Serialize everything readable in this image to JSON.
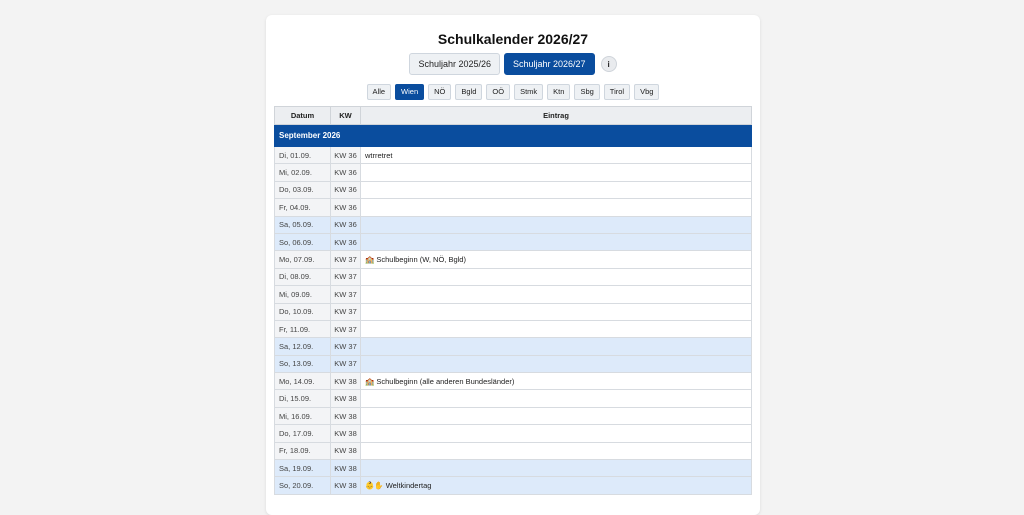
{
  "header": {
    "title": "Schulkalender 2026/27",
    "year_buttons": [
      {
        "label": "Schuljahr 2025/26",
        "active": false
      },
      {
        "label": "Schuljahr 2026/27",
        "active": true
      }
    ],
    "info_label": "i"
  },
  "regions": [
    {
      "label": "Alle",
      "active": false
    },
    {
      "label": "Wien",
      "active": true
    },
    {
      "label": "NÖ",
      "active": false
    },
    {
      "label": "Bgld",
      "active": false
    },
    {
      "label": "OÖ",
      "active": false
    },
    {
      "label": "Stmk",
      "active": false
    },
    {
      "label": "Ktn",
      "active": false
    },
    {
      "label": "Sbg",
      "active": false
    },
    {
      "label": "Tirol",
      "active": false
    },
    {
      "label": "Vbg",
      "active": false
    }
  ],
  "table": {
    "headers": {
      "date": "Datum",
      "kw": "KW",
      "entry": "Eintrag"
    },
    "month": "September 2026",
    "rows": [
      {
        "date": "Di, 01.09.",
        "kw": "KW 36",
        "entry": "wtrretret",
        "icon": "",
        "weekend": false,
        "week_start": false
      },
      {
        "date": "Mi, 02.09.",
        "kw": "KW 36",
        "entry": "",
        "icon": "",
        "weekend": false,
        "week_start": false
      },
      {
        "date": "Do, 03.09.",
        "kw": "KW 36",
        "entry": "",
        "icon": "",
        "weekend": false,
        "week_start": false
      },
      {
        "date": "Fr, 04.09.",
        "kw": "KW 36",
        "entry": "",
        "icon": "",
        "weekend": false,
        "week_start": false
      },
      {
        "date": "Sa, 05.09.",
        "kw": "KW 36",
        "entry": "",
        "icon": "",
        "weekend": true,
        "week_start": false
      },
      {
        "date": "So, 06.09.",
        "kw": "KW 36",
        "entry": "",
        "icon": "",
        "weekend": true,
        "week_start": false
      },
      {
        "date": "Mo, 07.09.",
        "kw": "KW 37",
        "entry": "Schulbeginn (W, NÖ, Bgld)",
        "icon": "🏫",
        "weekend": false,
        "week_start": true
      },
      {
        "date": "Di, 08.09.",
        "kw": "KW 37",
        "entry": "",
        "icon": "",
        "weekend": false,
        "week_start": false
      },
      {
        "date": "Mi, 09.09.",
        "kw": "KW 37",
        "entry": "",
        "icon": "",
        "weekend": false,
        "week_start": false
      },
      {
        "date": "Do, 10.09.",
        "kw": "KW 37",
        "entry": "",
        "icon": "",
        "weekend": false,
        "week_start": false
      },
      {
        "date": "Fr, 11.09.",
        "kw": "KW 37",
        "entry": "",
        "icon": "",
        "weekend": false,
        "week_start": false
      },
      {
        "date": "Sa, 12.09.",
        "kw": "KW 37",
        "entry": "",
        "icon": "",
        "weekend": true,
        "week_start": false
      },
      {
        "date": "So, 13.09.",
        "kw": "KW 37",
        "entry": "",
        "icon": "",
        "weekend": true,
        "week_start": false
      },
      {
        "date": "Mo, 14.09.",
        "kw": "KW 38",
        "entry": "Schulbeginn (alle anderen Bundesländer)",
        "icon": "🏫",
        "weekend": false,
        "week_start": true
      },
      {
        "date": "Di, 15.09.",
        "kw": "KW 38",
        "entry": "",
        "icon": "",
        "weekend": false,
        "week_start": false
      },
      {
        "date": "Mi, 16.09.",
        "kw": "KW 38",
        "entry": "",
        "icon": "",
        "weekend": false,
        "week_start": false
      },
      {
        "date": "Do, 17.09.",
        "kw": "KW 38",
        "entry": "",
        "icon": "",
        "weekend": false,
        "week_start": false
      },
      {
        "date": "Fr, 18.09.",
        "kw": "KW 38",
        "entry": "",
        "icon": "",
        "weekend": false,
        "week_start": false
      },
      {
        "date": "Sa, 19.09.",
        "kw": "KW 38",
        "entry": "",
        "icon": "",
        "weekend": true,
        "week_start": false
      },
      {
        "date": "So, 20.09.",
        "kw": "KW 38",
        "entry": "Weltkindertag",
        "icon": "👶✋",
        "weekend": true,
        "week_start": false
      }
    ]
  }
}
